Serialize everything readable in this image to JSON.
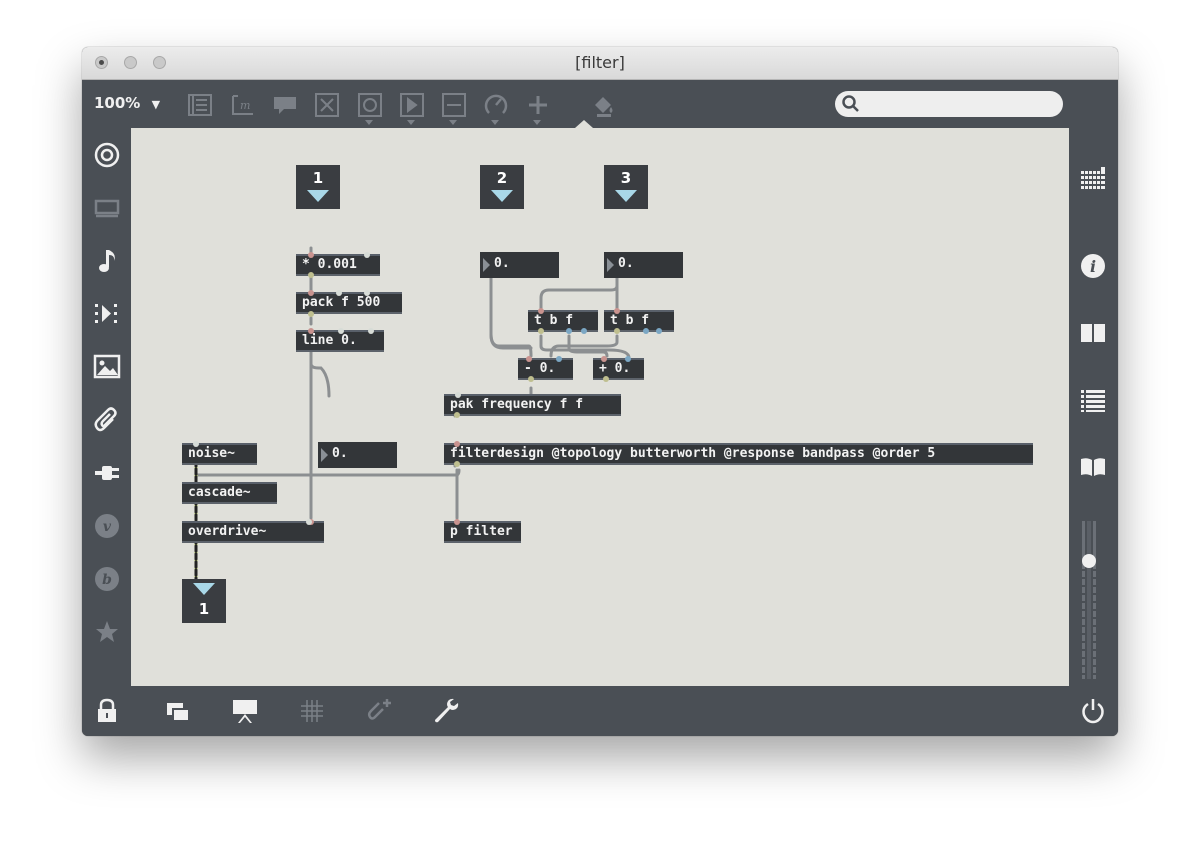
{
  "window": {
    "title": "[filter]"
  },
  "toolbar": {
    "zoom": "100%",
    "icons": [
      "bpatcher-icon",
      "message-icon",
      "comment-icon",
      "toggle-icon",
      "button-icon",
      "playbar-icon",
      "slider-icon",
      "dial-icon",
      "add-object-icon",
      "paint-bucket-icon"
    ],
    "search_placeholder": ""
  },
  "left_sidebar": [
    "target-icon",
    "presentation-icon",
    "music-note-icon",
    "playlist-icon",
    "image-icon",
    "paperclip-icon",
    "plug-icon",
    "vst-icon",
    "beap-icon",
    "star-icon"
  ],
  "right_sidebar": [
    "keyboard-icon",
    "info-icon",
    "book-columns-icon",
    "list-icon",
    "reference-book-icon"
  ],
  "bottom_bar": [
    "lock-icon",
    "presentation-toggle-icon",
    "present-icon",
    "grid-icon",
    "snap-icon",
    "wrench-icon",
    "power-icon"
  ],
  "patch": {
    "messages": [
      {
        "id": "msg1",
        "text": "1"
      },
      {
        "id": "msg2",
        "text": "2"
      },
      {
        "id": "msg3",
        "text": "3"
      },
      {
        "id": "dac",
        "text": "1"
      }
    ],
    "numbers": [
      {
        "id": "num-left",
        "value": "0."
      },
      {
        "id": "num-mid",
        "value": "0."
      },
      {
        "id": "num-right",
        "value": "0."
      }
    ],
    "objects": {
      "times": "* 0.001",
      "pack": "pack f 500",
      "line": "line 0.",
      "tbf1": "t b f",
      "tbf2": "t b f",
      "minus": "- 0.",
      "plus": "+ 0.",
      "pak": "pak frequency f f",
      "filterdesign": "filterdesign @topology butterworth @response bandpass @order 5",
      "noise": "noise~",
      "cascade": "cascade~",
      "overdrive": "overdrive~",
      "pfilter": "p filter"
    }
  }
}
